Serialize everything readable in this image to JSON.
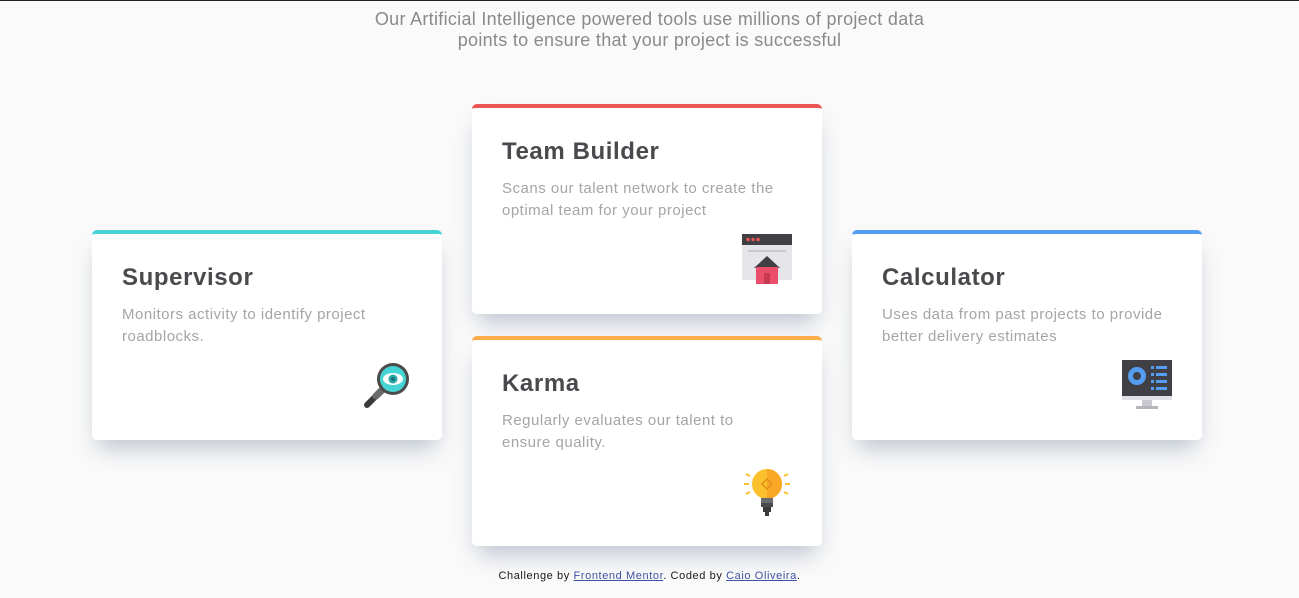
{
  "intro": {
    "line1": "Our Artificial Intelligence powered tools use millions of project data",
    "line2": "points to ensure that your project is successful"
  },
  "cards": [
    {
      "title": "Supervisor",
      "description": "Monitors activity to identify project roadblocks.",
      "accent": "#45d3d3",
      "icon": "magnifier-eye-icon"
    },
    {
      "title": "Team Builder",
      "description": "Scans our talent network to create the optimal team for your project",
      "accent": "#ea5454",
      "icon": "browser-house-icon"
    },
    {
      "title": "Karma",
      "description": "Regularly evaluates our talent to ensure quality.",
      "accent": "#fcae4a",
      "icon": "lightbulb-icon"
    },
    {
      "title": "Calculator",
      "description": "Uses data from past projects to provide better delivery estimates",
      "accent": "#549ef2",
      "icon": "monitor-dashboard-icon"
    }
  ],
  "footer": {
    "prefix": "Challenge by ",
    "challenge_link": "Frontend Mentor",
    "middle": ". Coded by ",
    "author_link": "Caio Oliveira",
    "suffix": "."
  }
}
